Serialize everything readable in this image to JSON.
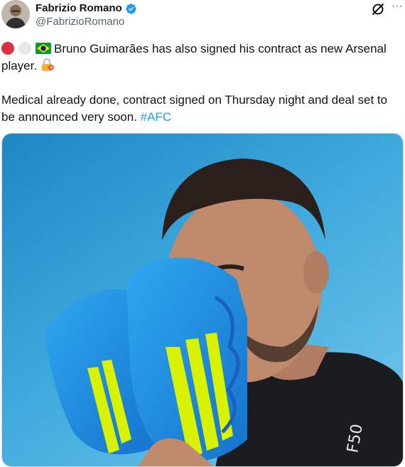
{
  "author": {
    "display_name": "Fabrizio Romano",
    "handle": "@FabrizioRomano",
    "verified": true,
    "verified_color": "#1d9bf0"
  },
  "actions": {
    "grok_icon": "grok-icon",
    "more_label": "···"
  },
  "tweet": {
    "text1_flags": [
      "red-circle",
      "white-circle",
      "brazil-flag"
    ],
    "text1": "Bruno Guimarães has also signed his contract as new Arsenal player.",
    "text1_emoji": "lock-with-key",
    "text2": "Medical already done, contract signed on Thursday night and deal set to be announced very soon.",
    "hashtag": "#AFC",
    "hashtag_color": "#1d9bf0"
  },
  "media": {
    "type": "photo",
    "background_color": "#3aa6d6",
    "boot_color": "#1e8fe0",
    "boot_stripe_color": "#d8f200",
    "shirt_text": "F50"
  }
}
